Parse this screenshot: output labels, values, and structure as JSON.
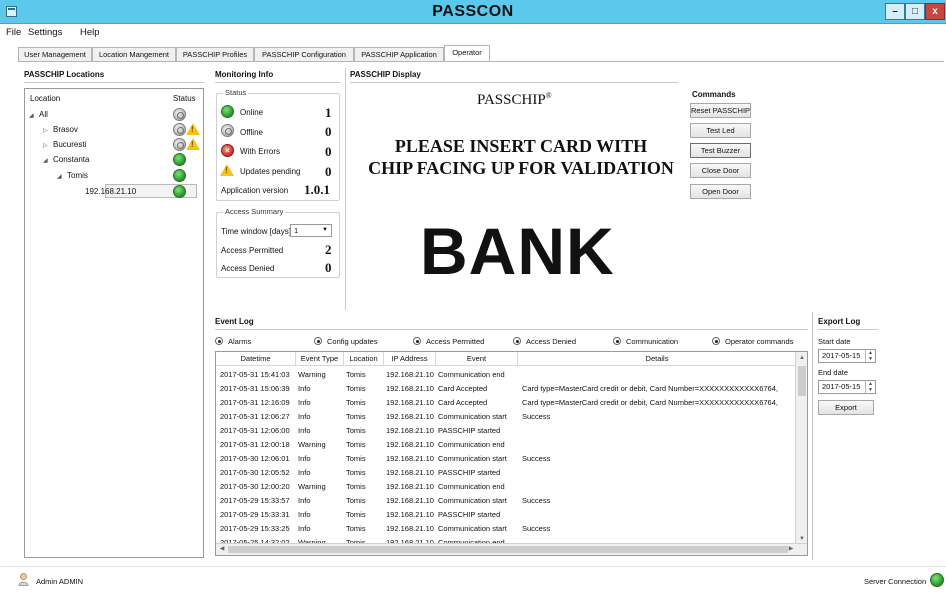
{
  "window": {
    "title": "PASSCON"
  },
  "menu": {
    "file": "File",
    "settings": "Settings",
    "help": "Help"
  },
  "tabs": [
    {
      "label": "User Management"
    },
    {
      "label": "Location Mangement"
    },
    {
      "label": "PASSCHIP Profiles"
    },
    {
      "label": "PASSCHIP Configuration"
    },
    {
      "label": "PASSCHIP Application"
    },
    {
      "label": "Operator"
    }
  ],
  "locations": {
    "title": "PASSCHIP Locations",
    "col_location": "Location",
    "col_status": "Status",
    "items": [
      {
        "label": "All",
        "level": 0,
        "expanded": true,
        "status": "gray"
      },
      {
        "label": "Brasov",
        "level": 1,
        "expanded": false,
        "status": "gray-warning"
      },
      {
        "label": "Bucuresti",
        "level": 1,
        "expanded": false,
        "status": "gray-warning"
      },
      {
        "label": "Constanta",
        "level": 1,
        "expanded": true,
        "status": "green"
      },
      {
        "label": "Tomis",
        "level": 2,
        "expanded": true,
        "status": "green"
      },
      {
        "label": "192.168.21.10",
        "level": 3,
        "selected": true,
        "status": "green"
      }
    ]
  },
  "monitoring": {
    "title": "Monitoring Info",
    "status_group": "Status",
    "online_label": "Online",
    "online_value": "1",
    "offline_label": "Offline",
    "offline_value": "0",
    "errors_label": "With Errors",
    "errors_value": "0",
    "updates_label": "Updates pending",
    "updates_value": "0",
    "version_label": "Application version",
    "version_value": "1.0.1",
    "access_group": "Access Summary",
    "time_window_label": "Time window [days]",
    "time_window_value": "1",
    "permitted_label": "Access Permitted",
    "permitted_value": "2",
    "denied_label": "Access Denied",
    "denied_value": "0"
  },
  "display": {
    "title": "PASSCHIP Display",
    "brand": "PASSCHIP",
    "reg": "®",
    "message_line1": "PLEASE INSERT CARD WITH",
    "message_line2": "CHIP FACING UP FOR VALIDATION",
    "bank": "BANK"
  },
  "commands": {
    "title": "Commands",
    "reset": "Reset PASSCHIP",
    "test_led": "Test Led",
    "test_buzzer": "Test Buzzer",
    "close_door": "Close Door",
    "open_door": "Open Door"
  },
  "event_log": {
    "title": "Event Log",
    "filters": [
      "Alarms",
      "Config updates",
      "Access Permitted",
      "Access Denied",
      "Communication",
      "Operator commands"
    ],
    "columns": [
      "Datetime",
      "Event Type",
      "Location",
      "IP Address",
      "Event",
      "Details"
    ],
    "rows": [
      [
        "2017-05-31 15:41:03",
        "Warning",
        "Tomis",
        "192.168.21.10",
        "Communication end",
        ""
      ],
      [
        "2017-05-31 15:06:39",
        "Info",
        "Tomis",
        "192.168.21.10",
        "Card Accepted",
        "Card type=MasterCard credit or debit, Card Number=XXXXXXXXXXXX6764,"
      ],
      [
        "2017-05-31 12:16:09",
        "Info",
        "Tomis",
        "192.168.21.10",
        "Card Accepted",
        "Card type=MasterCard credit or debit, Card Number=XXXXXXXXXXXX6764,"
      ],
      [
        "2017-05-31 12:06:27",
        "Info",
        "Tomis",
        "192.168.21.10",
        "Communication start",
        "Success"
      ],
      [
        "2017-05-31 12:06:00",
        "Info",
        "Tomis",
        "192.168.21.10",
        "PASSCHIP started",
        ""
      ],
      [
        "2017-05-31 12:00:18",
        "Warning",
        "Tomis",
        "192.168.21.10",
        "Communication end",
        ""
      ],
      [
        "2017-05-30 12:06:01",
        "Info",
        "Tomis",
        "192.168.21.10",
        "Communication start",
        "Success"
      ],
      [
        "2017-05-30 12:05:52",
        "Info",
        "Tomis",
        "192.168.21.10",
        "PASSCHIP started",
        ""
      ],
      [
        "2017-05-30 12:00:20",
        "Warning",
        "Tomis",
        "192.168.21.10",
        "Communication end",
        ""
      ],
      [
        "2017-05-29 15:33:57",
        "Info",
        "Tomis",
        "192.168.21.10",
        "Communication start",
        "Success"
      ],
      [
        "2017-05-29 15:33:31",
        "Info",
        "Tomis",
        "192.168.21.10",
        "PASSCHIP started",
        ""
      ],
      [
        "2017-05-29 15:33:25",
        "Info",
        "Tomis",
        "192.168.21.10",
        "Communication start",
        "Success"
      ],
      [
        "2017-05-25 14:32:02",
        "Warning",
        "Tomis",
        "192.168.21.10",
        "Communication end",
        ""
      ]
    ]
  },
  "export_log": {
    "title": "Export Log",
    "start_label": "Start date",
    "start_value": "2017-05-15",
    "end_label": "End date",
    "end_value": "2017-05-15",
    "export": "Export"
  },
  "statusbar": {
    "user": "Admin ADMIN",
    "server": "Server Connection",
    "server_status_color": "#2f9f2f"
  }
}
